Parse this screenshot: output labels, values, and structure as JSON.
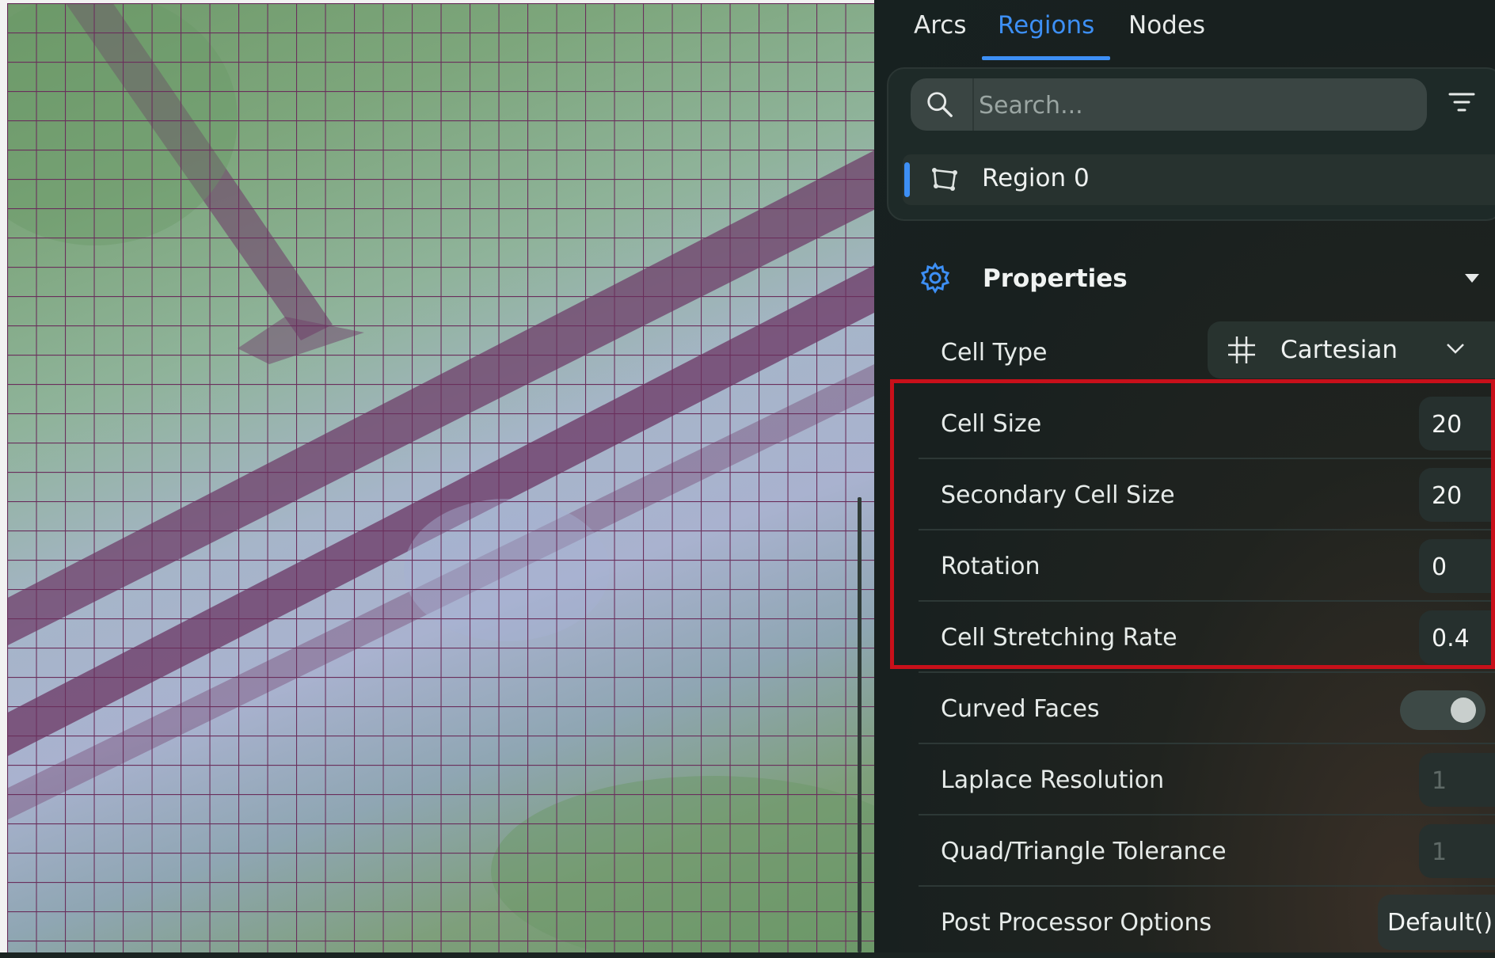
{
  "tabs": [
    {
      "label": "Arcs",
      "active": false
    },
    {
      "label": "Regions",
      "active": true
    },
    {
      "label": "Nodes",
      "active": false
    }
  ],
  "search": {
    "placeholder": "Search...",
    "value": ""
  },
  "regions": [
    {
      "label": "Region 0",
      "icon": "polygon-region-icon"
    }
  ],
  "properties": {
    "title": "Properties",
    "cell_type": {
      "label": "Cell Type",
      "value": "Cartesian",
      "icon": "cartesian-grid-icon"
    },
    "cell_size": {
      "label": "Cell Size",
      "value": "20"
    },
    "secondary_cell_size": {
      "label": "Secondary Cell Size",
      "value": "20"
    },
    "rotation": {
      "label": "Rotation",
      "value": "0"
    },
    "cell_stretching_rate": {
      "label": "Cell Stretching Rate",
      "value": "0.4"
    },
    "curved_faces": {
      "label": "Curved Faces",
      "enabled": false
    },
    "laplace_resolution": {
      "label": "Laplace Resolution",
      "value": "1"
    },
    "quad_triangle_tolerance": {
      "label": "Quad/Triangle Tolerance",
      "value": "1"
    },
    "post_processor_options": {
      "label": "Post Processor Options",
      "value": "Default()"
    }
  },
  "colors": {
    "accent": "#3d8ff5",
    "highlight": "#c8101a",
    "grid": "#6a2f5c"
  }
}
